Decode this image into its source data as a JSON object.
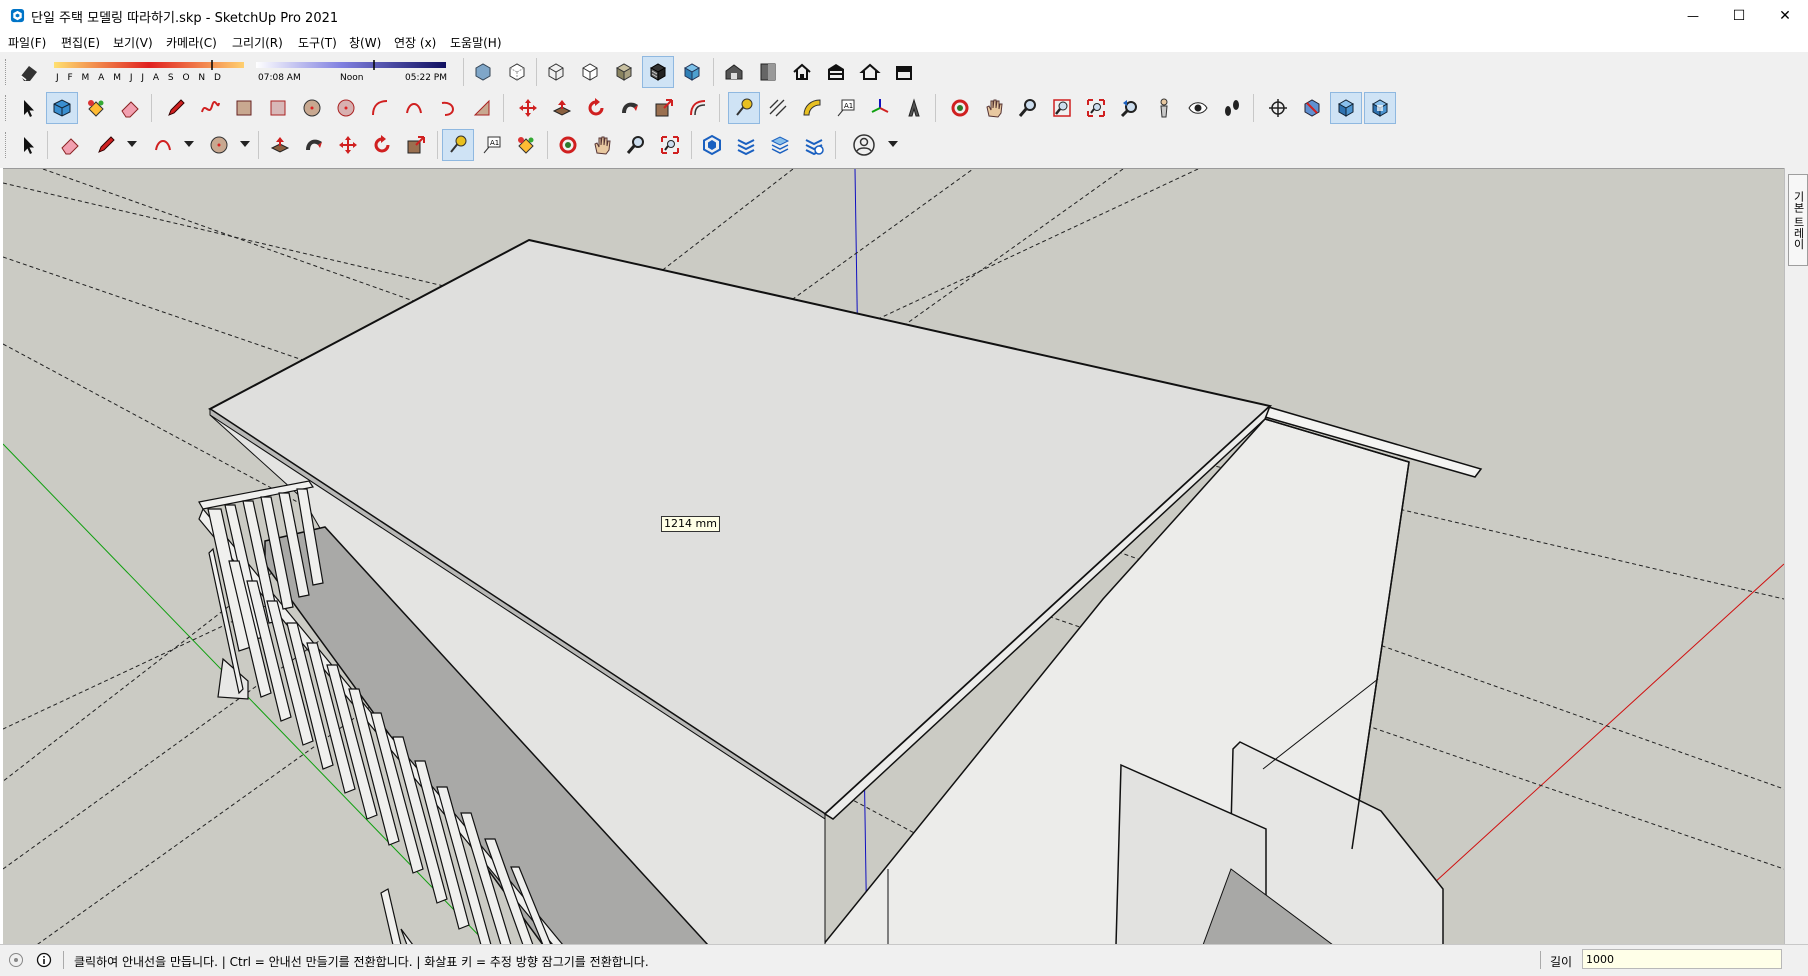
{
  "window": {
    "title": "단일 주택 모델링 따라하기.skp - SketchUp Pro 2021",
    "minimize_glyph": "—",
    "maximize_glyph": "☐",
    "close_glyph": "✕"
  },
  "menu": [
    "파일(F)",
    "편집(E)",
    "보기(V)",
    "카메라(C)",
    "그리기(R)",
    "도구(T)",
    "창(W)",
    "연장 (x)",
    "도움말(H)"
  ],
  "shadow": {
    "months": "J F M A M J J A S O N D",
    "time_start": "07:08 AM",
    "time_mid": "Noon",
    "time_end": "05:22 PM"
  },
  "icons": {
    "row1": [
      "eraser-icon",
      "iso-view-icon",
      "top-view-icon",
      "front-view-icon",
      "right-view-icon",
      "back-view-icon",
      "left-view-icon",
      "xray-icon",
      "wireframe-icon",
      "hidden-line-icon",
      "shaded-icon",
      "shaded-textures-icon",
      "monochrome-icon",
      "warehouse-icon",
      "extension-warehouse-icon",
      "home-icon",
      "warehouse-share-icon",
      "house-outline-icon",
      "warehouse-component-icon"
    ],
    "row2": [
      "select-icon",
      "component-icon",
      "paint-bucket-icon",
      "eraser-icon",
      "pencil-icon",
      "freehand-icon",
      "rectangle-icon",
      "rotated-rectangle-icon",
      "circle-icon",
      "polygon-icon",
      "arc-icon",
      "two-point-arc-icon",
      "three-point-arc-icon",
      "pie-icon",
      "move-icon",
      "push-pull-icon",
      "rotate-icon",
      "follow-me-icon",
      "scale-icon",
      "offset-icon",
      "tape-measure-icon",
      "dimension-icon",
      "protractor-icon",
      "text-icon",
      "axes-icon",
      "3d-text-icon",
      "orbit-icon",
      "pan-icon",
      "zoom-icon",
      "zoom-window-icon",
      "zoom-extents-icon",
      "previous-view-icon",
      "position-camera-icon",
      "look-around-icon",
      "walk-icon",
      "section-plane-icon",
      "display-section-planes-icon",
      "display-section-cuts-icon",
      "display-section-fill-icon"
    ],
    "row3": [
      "select-icon",
      "eraser-icon",
      "pencil-icon",
      "arc-icon",
      "circle-icon",
      "push-pull-icon",
      "follow-me-icon",
      "move-icon",
      "rotate-icon",
      "scale-icon",
      "tape-measure-icon",
      "text-icon",
      "paint-bucket-icon",
      "orbit-icon",
      "pan-icon",
      "zoom-icon",
      "zoom-extents-icon",
      "warehouse-icon",
      "extension-icon",
      "layers-icon",
      "model-info-icon",
      "account-icon"
    ]
  },
  "viewport": {
    "measurement": "1214 mm"
  },
  "tray": {
    "label": "기본 트레이"
  },
  "status": {
    "message": "클릭하여 안내선을 만듭니다. | Ctrl = 안내선 만들기를 전환합니다. | 화살표 키 = 추정 방향 잠그기를 전환합니다.",
    "measure_label": "길이",
    "measure_value": "1000"
  },
  "colors": {
    "sketchup_blue": "#0074c7",
    "ground": "#cbcbc4",
    "axis_red": "#d01010",
    "axis_green": "#10a010",
    "axis_blue": "#1010c0"
  }
}
